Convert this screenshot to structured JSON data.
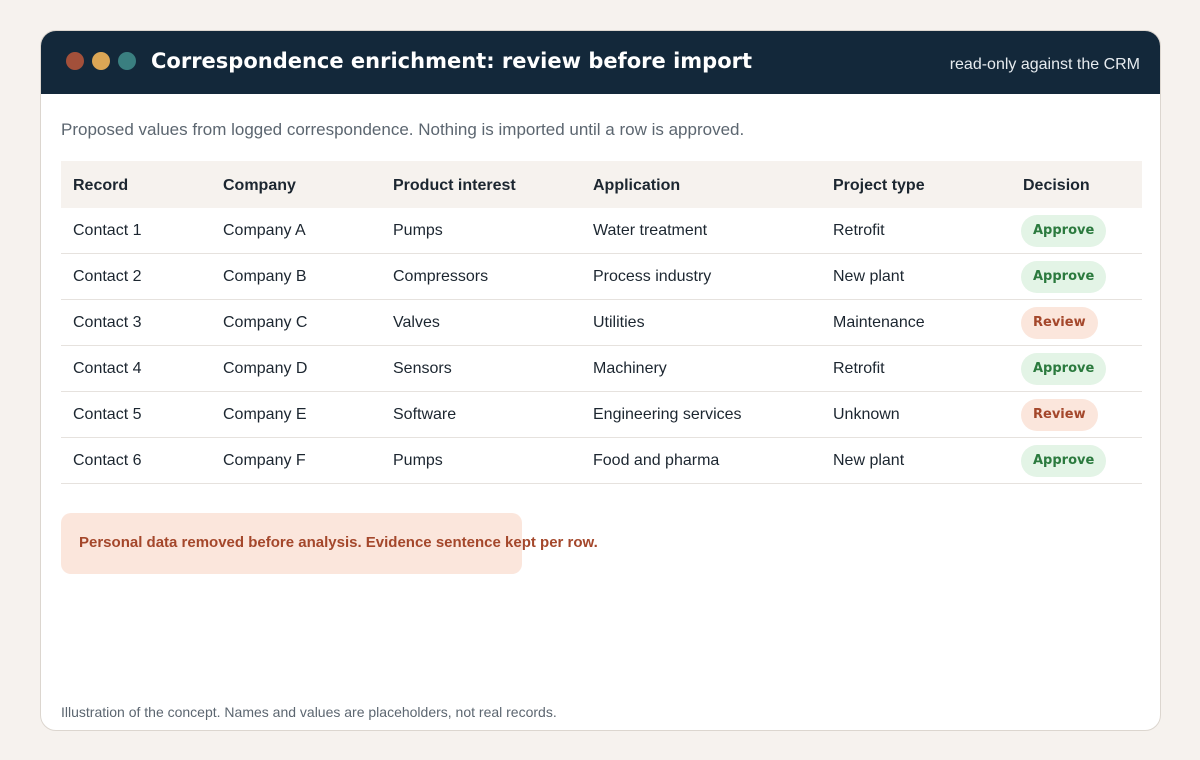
{
  "window": {
    "title": "Correspondence enrichment: review before import",
    "mode_note": "read-only against the CRM",
    "dots": {
      "red": "#a3503a",
      "yellow": "#dba655",
      "green": "#3a7f80"
    }
  },
  "subtitle": "Proposed values from logged correspondence. Nothing is imported until a row is approved.",
  "table": {
    "headers": [
      "Record",
      "Company",
      "Product interest",
      "Application",
      "Project type",
      "Decision"
    ],
    "rows": [
      {
        "record": "Contact 1",
        "company": "Company A",
        "product": "Pumps",
        "application": "Water treatment",
        "project": "Retrofit",
        "decision": "Approve"
      },
      {
        "record": "Contact 2",
        "company": "Company B",
        "product": "Compressors",
        "application": "Process industry",
        "project": "New plant",
        "decision": "Approve"
      },
      {
        "record": "Contact 3",
        "company": "Company C",
        "product": "Valves",
        "application": "Utilities",
        "project": "Maintenance",
        "decision": "Review"
      },
      {
        "record": "Contact 4",
        "company": "Company D",
        "product": "Sensors",
        "application": "Machinery",
        "project": "Retrofit",
        "decision": "Approve"
      },
      {
        "record": "Contact 5",
        "company": "Company E",
        "product": "Software",
        "application": "Engineering services",
        "project": "Unknown",
        "decision": "Review"
      },
      {
        "record": "Contact 6",
        "company": "Company F",
        "product": "Pumps",
        "application": "Food and pharma",
        "project": "New plant",
        "decision": "Approve"
      }
    ]
  },
  "notice": "Personal data removed before analysis. Evidence sentence kept per row.",
  "footer": "Illustration of the concept. Names and values are placeholders, not real records.",
  "colors": {
    "titlebar": "#13283a",
    "approve_bg": "#e3f4e6",
    "approve_text": "#2b7a3e",
    "review_bg": "#fbe6dc",
    "review_text": "#a4472b"
  }
}
